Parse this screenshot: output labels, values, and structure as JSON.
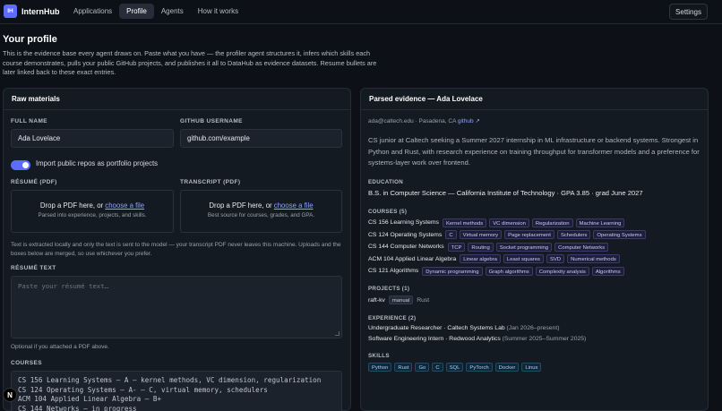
{
  "app": {
    "logo": "IH",
    "name": "InternHub"
  },
  "nav": [
    {
      "label": "Applications",
      "active": false
    },
    {
      "label": "Profile",
      "active": true
    },
    {
      "label": "Agents",
      "active": false
    },
    {
      "label": "How it works",
      "active": false
    }
  ],
  "settings_label": "Settings",
  "page": {
    "title": "Your profile",
    "description": "This is the evidence base every agent draws on. Paste what you have — the profiler agent structures it, infers which skills each course demonstrates, pulls your public GitHub projects, and publishes it all to DataHub as evidence datasets. Resume bullets are later linked back to these exact entries."
  },
  "raw": {
    "title": "Raw materials",
    "full_name_label": "FULL NAME",
    "full_name_value": "Ada Lovelace",
    "github_label": "GITHUB USERNAME",
    "github_placeholder": "github.com/example",
    "import_toggle_label": "Import public repos as portfolio projects",
    "import_toggle_on": true,
    "resume_pdf_label": "RÉSUMÉ (PDF)",
    "resume_drop_prefix": "Drop a PDF here, or ",
    "resume_drop_link": "choose a file",
    "resume_drop_sub": "Parsed into experience, projects, and skills.",
    "transcript_pdf_label": "TRANSCRIPT (PDF)",
    "transcript_drop_prefix": "Drop a PDF here, or ",
    "transcript_drop_link": "choose a file",
    "transcript_drop_sub": "Best source for courses, grades, and GPA.",
    "privacy_note": "Text is extracted locally and only the text is sent to the model — your transcript PDF never leaves this machine. Uploads and the boxes below are merged, so use whichever you prefer.",
    "resume_text_label": "RÉSUMÉ TEXT",
    "resume_text_placeholder": "Paste your résumé text…",
    "resume_text_helper": "Optional if you attached a PDF above.",
    "courses_label": "COURSES",
    "courses_text": "CS 156 Learning Systems — A — kernel methods, VC dimension, regularization\nCS 124 Operating Systems — A- — C, virtual memory, schedulers\nACM 104 Applied Linear Algebra — B+\nCS 144 Networks — in progress"
  },
  "parsed": {
    "title": "Parsed evidence — Ada Lovelace",
    "email": "ada@caltech.edu",
    "location": "Pasadena, CA",
    "github_link": "github ↗",
    "summary": "CS junior at Caltech seeking a Summer 2027 internship in ML infrastructure or backend systems. Strongest in Python and Rust, with research experience on training throughput for transformer models and a preference for systems-layer work over frontend.",
    "education_label": "EDUCATION",
    "education": "B.S. in Computer Science — California Institute of Technology · GPA 3.85 · grad June 2027",
    "courses_label": "COURSES (5)",
    "courses": [
      {
        "name": "CS 156 Learning Systems",
        "tags": [
          "Kernel methods",
          "VC dimension",
          "Regularization",
          "Machine Learning"
        ]
      },
      {
        "name": "CS 124 Operating Systems",
        "tags": [
          "C",
          "Virtual memory",
          "Page replacement",
          "Schedulers",
          "Operating Systems"
        ]
      },
      {
        "name": "CS 144 Computer Networks",
        "tags": [
          "TCP",
          "Routing",
          "Socket programming",
          "Computer Networks"
        ]
      },
      {
        "name": "ACM 104 Applied Linear Algebra",
        "tags": [
          "Linear algebra",
          "Least squares",
          "SVD",
          "Numerical methods"
        ]
      },
      {
        "name": "CS 121 Algorithms",
        "tags": [
          "Dynamic programming",
          "Graph algorithms",
          "Complexity analysis",
          "Algorithms"
        ]
      }
    ],
    "projects_label": "PROJECTS (1)",
    "project": {
      "name": "raft-kv",
      "tag": "manual",
      "lang": "Rust"
    },
    "experience_label": "EXPERIENCE (2)",
    "experience": [
      {
        "role": "Undergraduate Researcher",
        "org": " · Caltech Systems Lab",
        "dates": " (Jan 2026–present)"
      },
      {
        "role": "Software Engineering Intern",
        "org": " · Redwood Analytics",
        "dates": " (Summer 2025–Summer 2025)"
      }
    ],
    "skills_label": "SKILLS",
    "skills": [
      "Python",
      "Rust",
      "Go",
      "C",
      "SQL",
      "PyTorch",
      "Docker",
      "Linux"
    ]
  },
  "corner_badge": "N",
  "colors": {
    "accent": "#5b6cff",
    "background": "#0d1117",
    "panel": "#141a22"
  }
}
